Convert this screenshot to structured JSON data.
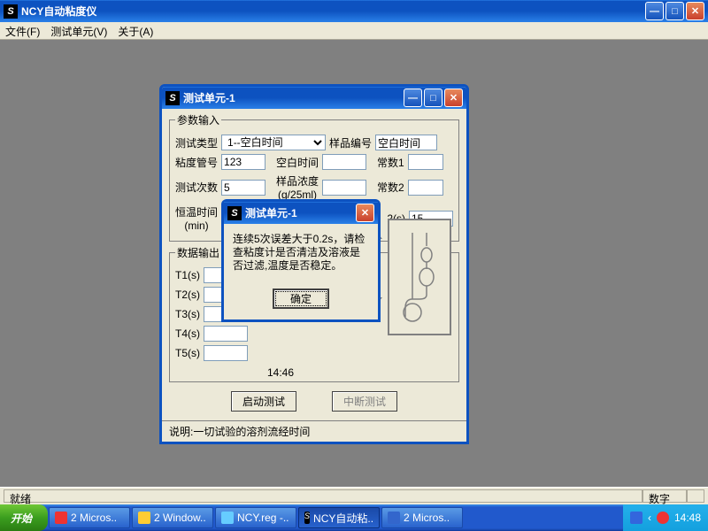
{
  "app": {
    "title": "NCY自动粘度仪",
    "menus": [
      "文件(F)",
      "测试单元(V)",
      "关于(A)"
    ]
  },
  "child": {
    "title": "测试单元-1",
    "groups": {
      "params": "参数输入",
      "output": "数据输出"
    },
    "labels": {
      "testType": "测试类型",
      "sampleNo": "样品编号",
      "tubeNo": "粘度管号",
      "blankTime": "空白时间",
      "const1": "常数1",
      "testCount": "测试次数",
      "conc": "样品浓度\n(g/25ml)",
      "const2": "常数2",
      "bathTime": "恒温时间\n(min)",
      "t2s": "2(s)",
      "t1": "T1(s)",
      "t2": "T2(s)",
      "t3": "T3(s)",
      "t4": "T4(s)",
      "t5": "T5(s)"
    },
    "values": {
      "testType": "1--空白时间",
      "sampleNo": "空白时间",
      "tubeNo": "123",
      "testCount": "5",
      "t2s": "15",
      "time": "14:46"
    },
    "buttons": {
      "start": "启动测试",
      "stop": "中断测试"
    },
    "explain": "说明:一切试验的溶剂流经时间"
  },
  "msg": {
    "title": "测试单元-1",
    "text": "连续5次误差大于0.2s，请检查粘度计是否清洁及溶液是否过滤,温度是否稳定。",
    "ok": "确定"
  },
  "status": {
    "ready": "就绪",
    "numlock": "数字"
  },
  "taskbar": {
    "start": "开始",
    "items": [
      "2 Micros..",
      "2 Window..",
      "NCY.reg -..",
      "NCY自动粘..",
      "2 Micros.."
    ],
    "clock": "14:48"
  }
}
